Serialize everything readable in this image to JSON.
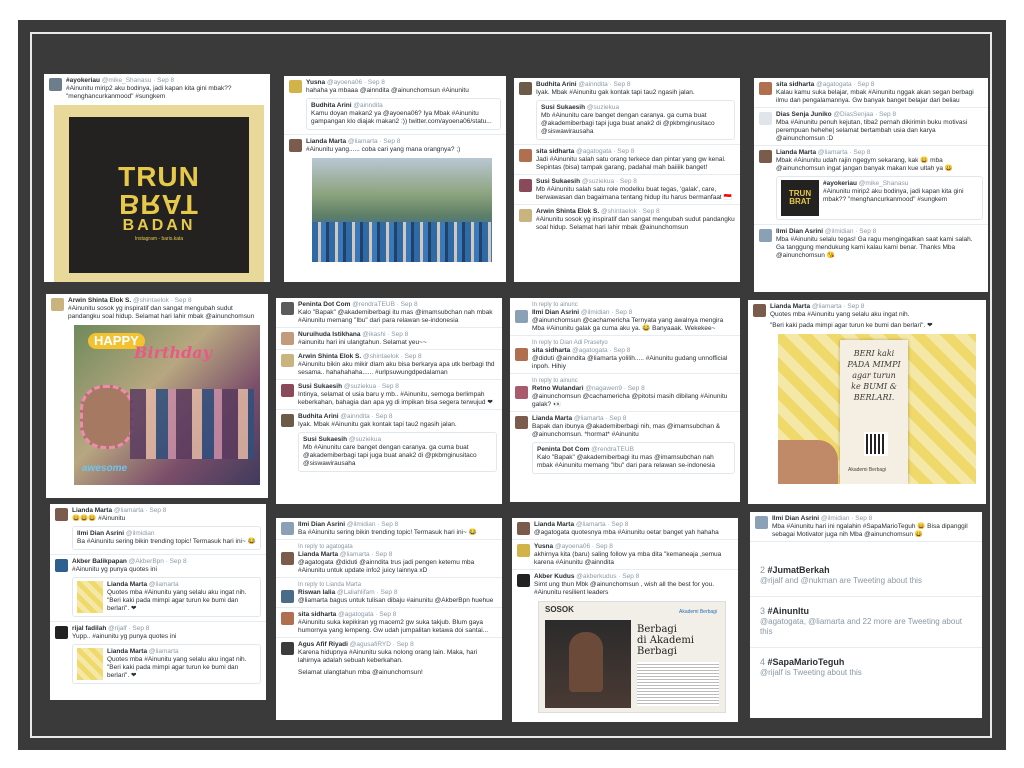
{
  "c1": {
    "name": "#ayokeriau",
    "handle": "@mike_Shanasu · Sep 8",
    "text": "#Ainunitu mirip2 aku bodinya, jadi kapan kita gini mbak?? \"menghancurkanmood\" #sungkem",
    "poster_lines": [
      "TRUN",
      "BRAT",
      "BADAN"
    ],
    "poster_credit": "Instagram - baris.kata"
  },
  "c2": {
    "t1_name": "Yusna",
    "t1_handle": "@ayoena06 · Sep 8",
    "t1_text": "hahaha ya mbaaa @ainndita @ainunchomsun #Ainunitu",
    "q_name": "Budhita Arini",
    "q_handle": "@ainndita",
    "q_text": "Kamu doyan makan2 ya @ayoena06? Iya Mbak #Ainunitu gampangan klo diajak makan2 :)) twitter.com/ayoena06/statu...",
    "t2_name": "Lianda Marta",
    "t2_handle": "@liamarta · Sep 8",
    "t2_text": "#Ainunitu yang...... coba cari yang mana orangnya? ;)"
  },
  "c3": {
    "t1_name": "Budhita Arini",
    "t1_handle": "@ainndita · Sep 8",
    "t1_text": "Iyak. Mbak #Ainunitu gak kontak tapi tau2 ngasih jalan.",
    "q_name": "Susi Sukaesih",
    "q_handle": "@suziekua",
    "q_text": "Mb #Ainunitu care banget dengan caranya. ga cuma buat @akademiberbagi tapi juga buat anak2 di @pkbmginusitaco @siswawirausaha",
    "t2_name": "sita sidharta",
    "t2_handle": "@agatogata · Sep 8",
    "t2_text": "Jadi #Ainunitu salah satu orang terkece dan pintar yang gw kenal. Sepintas (bisa) tampak garang, padahal mah baiiiik banget!",
    "t3_name": "Susi Sukaesih",
    "t3_handle": "@suziekua · Sep 8",
    "t3_text": "Mb #Ainunitu salah satu role modelku buat tegas, 'galak', care, berwawasan dan bagaimana tentang hidup itu harus bermanfaat 🇮🇩",
    "t4_name": "Arwin Shinta Elok S.",
    "t4_handle": "@shintaelok · Sep 8",
    "t4_text": "#Ainunitu sosok yg inspiratif dan sangat mengubah sudut pandangku soal hidup. Selamat hari lahir mbak @ainunchomsun"
  },
  "c4": {
    "t1_name": "sita sidharta",
    "t1_handle": "@agatogata · Sep 8",
    "t1_text": "Kalau kamu suka belajar, mbak #Ainunitu nggak akan segan berbagi ilmu dan pengalamannya. Gw banyak banget belajar dari beliau",
    "t2_name": "Dias Senja Juniko",
    "t2_handle": "@DiasSenjaa · Sep 8",
    "t2_text": "Mba #Ainunitu penuh kejutan, tiba2 pernah dikirimin buku motivasi perempuan hehehe| selamat bertambah usia dan karya @ainunchomsun :D",
    "t3_name": "Lianda Marta",
    "t3_handle": "@liamarta · Sep 8",
    "t3_text": "Mbak #Ainunitu udah rajin ngegym sekarang, kak 😀 mba @ainunchomsun ingat jangan banyak makan kue ultah ya 😀",
    "q_name": "#ayokeriau",
    "q_handle": "@mike_Shanasu",
    "q_text": "#Ainunitu mirip2 aku bodinya, jadi kapan kita gini mbak?? \"menghancurkanmood\" #sungkem",
    "t4_name": "Ilmi Dian Asrini",
    "t4_handle": "@ilmidian · Sep 8",
    "t4_text": "Mba #Ainunitu selalu tegas! Ga ragu mengingatkan saat kami salah. Ga tanggung mendukung kami kalau kami benar. Thanks Mba @ainunchomsun 😘"
  },
  "c5": {
    "name": "Arwin Shinta Elok S.",
    "handle": "@shintaelok · Sep 8",
    "text": "#Ainunitu sosok yg inspiratif dan sangat mengubah sudut pandangku soal hidup. Selamat hari lahir mbak @ainunchomsun",
    "happy": "HAPPY",
    "birthday": "Birthday",
    "awesome": "awesome"
  },
  "c6": {
    "t1_name": "Peninta Dot Com",
    "t1_handle": "@rendraTEUB · Sep 8",
    "t1_text": "Kalo \"Bapak\" @akademiberbagi itu mas @imamsubchan nah mbak #Ainunitu memang \"Ibu\" dari para relawan se-indonesia",
    "t2_name": "Nuruihuda Istikhana",
    "t2_handle": "@ikashi · Sep 8",
    "t2_text": "#ainunitu hari ini ulangtahun. Selamat yeu~~",
    "t3_name": "Arwin Shinta Elok S.",
    "t3_handle": "@shintaelok · Sep 8",
    "t3_text": "#Ainunitu bikin aku mikir dlam aku bisa berkarya apa utk berbagi thd sesama.. hahahahaha...... #urlpsuwungdpedalaman",
    "t4_name": "Susi Sukaesih",
    "t4_handle": "@suziekua · Sep 8",
    "t4_text": "Intinya, selamat ol usia baru y mb.. #Ainunitu, semoga berlimpah keberkahan, bahagia dan apa yg di impikan bisa segera terwujud ❤",
    "t5_name": "Budhita Arini",
    "t5_handle": "@ainndita · Sep 8",
    "t5_text": "Iyak. Mbak #Ainunitu gak kontak tapi tau2 ngasih jalan.",
    "q_name": "Susi Sukaesih",
    "q_handle": "@suziekua",
    "q_text": "Mb #Ainunitu care banget dengan caranya. ga cuma buat @akademiberbagi tapi juga buat anak2 di @pkbmginusitaco @siswawirausaha"
  },
  "c7": {
    "r1": "In reply to ainunc",
    "t1_name": "Ilmi Dian Asrini",
    "t1_handle": "@ilmidian · Sep 8",
    "t1_text": "@ainunchomsun @cachamericha Ternyata yang awalnya mengira Mba #Ainunitu galak ga cuma aku ya. 😂 Banyaaak. Wekekee~",
    "r2": "In reply to Dian Adi Prasetyo",
    "t2_name": "sita sidharta",
    "t2_handle": "@agatogata · Sep 8",
    "t2_text": "@diduti @ainndita @liamarta yolilih..... #Ainunitu gudang unnofficial inpoh. Hihiy",
    "r3": "In reply to ainunc",
    "t3_name": "Retno Wulandari",
    "t3_handle": "@nagawen9 · Sep 8",
    "t3_text": "@ainunchomsun @cachamericha @pitotsi masih dibilang #Ainunitu galak? 👀",
    "t4_name": "Lianda Marta",
    "t4_handle": "@liamarta · Sep 8",
    "t4_text": "Bapak dan ibunya @akademiberbagi nih, mas @imamsubchan & @ainunchomsun. *hormat* #Ainunitu",
    "q_name": "Peninta Dot Com",
    "q_handle": "@rendraTEUB",
    "q_text": "Kalo \"Bapak\" @akademiberbagi itu mas @imamsubchan nah mbak #Ainunitu memang \"Ibu\" dari para relawan se-indonesia"
  },
  "c8": {
    "name": "Lianda Marta",
    "handle": "@liamarta · Sep 8",
    "text": "Quotes mba #Ainunitu yang selalu aku ingat nih.",
    "text2": "\"Beri kaki pada mimpi agar turun ke bumi dan berlari\". ❤",
    "card_text": [
      "BERI kaki",
      "PADA MIMPI",
      "agar turun",
      "ke BUMI &",
      "BERLARI."
    ],
    "logo": "Akademi Berbagi"
  },
  "c9": {
    "t1_name": "Lianda Marta",
    "t1_handle": "@liamarta · Sep 8",
    "t1_text": "😀😀😀 #Ainunitu",
    "q1_name": "Ilmi Dian Asrini",
    "q1_handle": "@ilmidian",
    "q1_text": "Ba #Ainunitu sering bikin trending topic! Termasuk hari ini~ 😂",
    "t2_name": "Akber Balikpapan",
    "t2_handle": "@AkberBpn · Sep 8",
    "t2_text": "#Ainunitu yg punya quotes ini",
    "q2_name": "Lianda Marta",
    "q2_handle": "@liamarta",
    "q2_text": "Quotes mba #Ainunitu yang selalu aku ingat nih.",
    "q2_text2": "\"Beri kaki pada mimpi agar turun ke bumi dan berlari\". ❤",
    "t3_name": "rijal fadilah",
    "t3_handle": "@rijalf · Sep 8",
    "t3_text": "Yupp.. #ainunitu yg punya quotes ini",
    "q3_name": "Lianda Marta",
    "q3_handle": "@liamarta",
    "q3_text": "Quotes mba #Ainunitu yang selalu aku ingat nih.",
    "q3_text2": "\"Beri kaki pada mimpi agar turun ke bumi dan berlari\". ❤"
  },
  "c10": {
    "t1_name": "Ilmi Dian Asrini",
    "t1_handle": "@ilmidian · Sep 8",
    "t1_text": "Ba #Ainunitu sering bikin trending topic! Termasuk hari ini~ 😂",
    "r1": "In reply to agatogata",
    "t2_name": "Lianda Marta",
    "t2_handle": "@liamarta · Sep 8",
    "t2_text": "@agatogata @diduti @ainndita trus jadi pengen ketemu mba #Ainunitu untuk update info2 juicy lainnya xD",
    "r2": "In reply to Lianda Marta",
    "t3_name": "Riswan lalia",
    "t3_handle": "@Laliahlifam · Sep 8",
    "t3_text": "@liamarta bagus untuk tulisan dibaju #ainunitu @AkberBpn huehue",
    "t4_name": "sita sidharta",
    "t4_handle": "@agatogata · Sep 8",
    "t4_text": "#Ainunitu suka kepikiran yg macem2 gw suka takjub. Blum gaya humornya yang lempeng. Gw udah jumpalitan ketawa doi santai...",
    "t5_name": "Agus Afif Riyadi",
    "t5_handle": "@agusafiRYD · Sep 8",
    "t5_text": "Karena hidupnya #Ainunitu suka nolong orang lain. Maka, hari lahirnya adalah sebuah keberkahan.",
    "t5_text2": "Selamat ulangtahun mba @ainunchomsun!"
  },
  "c11": {
    "t1_name": "Lianda Marta",
    "t1_handle": "@liamarta · Sep 8",
    "t1_text": "@agatogata quotesnya mba #Ainunitu oetar banget yah hahaha",
    "t2_name": "Yusna",
    "t2_handle": "@ayoena06 · Sep 8",
    "t2_text": "akhirnya kita (baru) saling follow ya mba dita \"kemaneaja ,semua karena #Ainunitu @ainndita",
    "t3_name": "Akber Kudus",
    "t3_handle": "@akberkudus · Sep 8",
    "t3_text": "Simt ung thun Mbk @ainunchomsun , wish all the best for you. #Ainunitu resilient leaders",
    "sosok": "SOSOK",
    "headline": [
      "Berbagi",
      "di Akademi",
      "Berbagi"
    ],
    "logo": "Akademi Berbagi"
  },
  "c12": {
    "name": "Ilmi Dian Asrini",
    "handle": "@ilmidian · Sep 8",
    "text": "Mba #Ainunitu hari ini ngalahin #SapaMarioTeguh 😄 Bisa dipanggil sebagai Motivator juga nih Mba @ainunchomsun 😄",
    "trends": [
      {
        "rank": "2",
        "tag": "#JumatBerkah",
        "desc": "@rijalf and @nukman are Tweeting about this"
      },
      {
        "rank": "3",
        "tag": "#AinunItu",
        "desc": "@agatogata, @liamarta and 22 more are Tweeting about this"
      },
      {
        "rank": "4",
        "tag": "#SapaMarioTeguh",
        "desc": "@rijalf is Tweeting about this"
      }
    ]
  }
}
